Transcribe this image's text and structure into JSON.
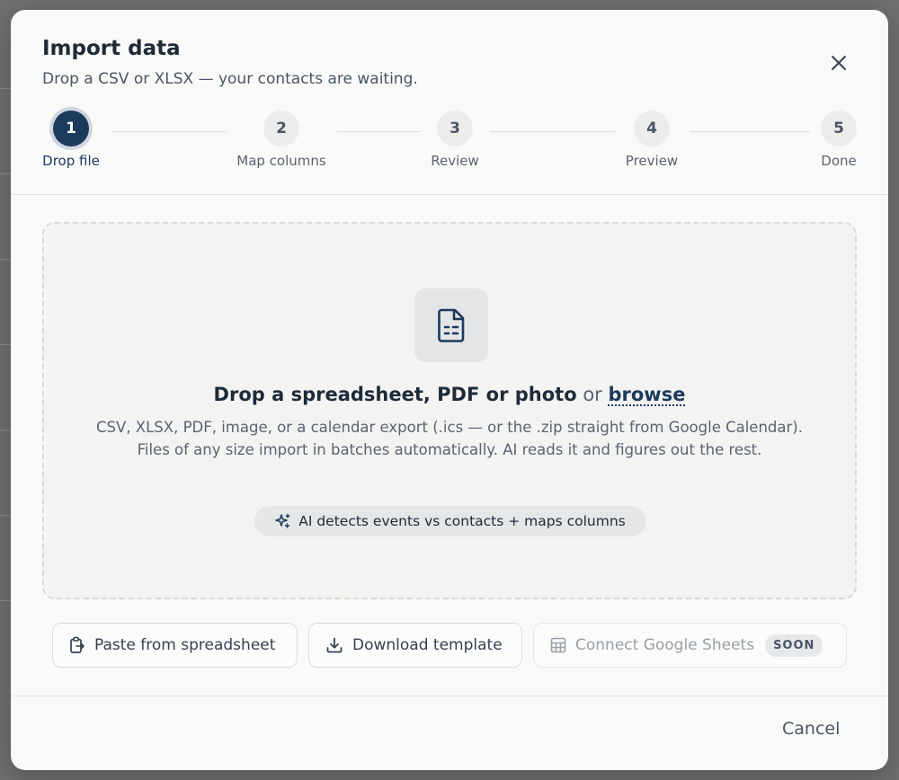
{
  "dialog": {
    "title": "Import data",
    "subtitle": "Drop a CSV or XLSX — your contacts are waiting."
  },
  "stepper": {
    "active_step": 1,
    "steps": [
      {
        "number": "1",
        "label": "Drop file"
      },
      {
        "number": "2",
        "label": "Map columns"
      },
      {
        "number": "3",
        "label": "Review"
      },
      {
        "number": "4",
        "label": "Preview"
      },
      {
        "number": "5",
        "label": "Done"
      }
    ]
  },
  "dropzone": {
    "icon": "file-spreadsheet-icon",
    "heading_strong": "Drop a spreadsheet, PDF or photo",
    "heading_or": "or",
    "browse_label": "browse",
    "description": "CSV, XLSX, PDF, image, or a calendar export (.ics — or the .zip straight from Google Calendar). Files of any size import in batches automatically. AI reads it and figures out the rest.",
    "ai_pill_icon": "sparkles-icon",
    "ai_pill_label": "AI detects events vs contacts + maps columns"
  },
  "actions": {
    "paste": {
      "label": "Paste from spreadsheet",
      "icon": "clipboard-paste-icon"
    },
    "download": {
      "label": "Download template",
      "icon": "download-icon"
    },
    "google_sheets": {
      "label": "Connect Google Sheets",
      "icon": "table-grid-icon",
      "badge": "SOON"
    }
  },
  "footer": {
    "cancel_label": "Cancel"
  },
  "colors": {
    "accent": "#1b3a5c",
    "modal_background": "#f9f9f7",
    "overlay": "#6f6f6f"
  }
}
